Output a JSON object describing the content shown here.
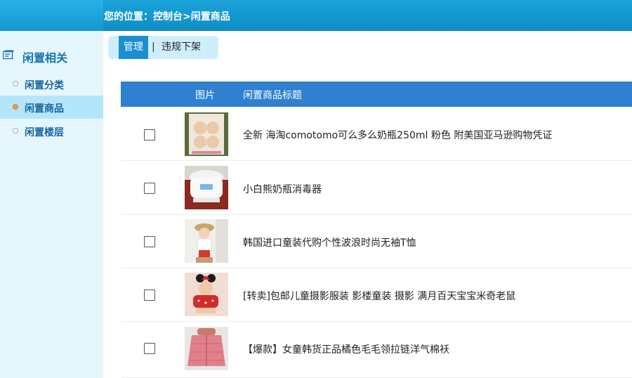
{
  "header": {
    "breadcrumb": "您的位置：控制台>闲置商品"
  },
  "sidebar": {
    "title": "闲置相关",
    "items": [
      {
        "label": "闲置分类",
        "active": false
      },
      {
        "label": "闲置商品",
        "active": true
      },
      {
        "label": "闲置楼层",
        "active": false
      }
    ]
  },
  "tabs": {
    "manage": "管理",
    "separator": "|",
    "offshelf": "违规下架"
  },
  "table": {
    "columns": {
      "image": "图片",
      "title": "闲置商品标题"
    },
    "rows": [
      {
        "title": "全新 海淘comotomo可么多么奶瓶250ml 粉色 附美国亚马逊购物凭证",
        "checked": false,
        "thumb": "baby-bottle-box"
      },
      {
        "title": "小白熊奶瓶消毒器",
        "checked": false,
        "thumb": "bottle-sterilizer"
      },
      {
        "title": "韩国进口童装代购个性波浪时尚无袖T恤",
        "checked": false,
        "thumb": "child-in-hat"
      },
      {
        "title": "[转卖]包邮儿童摄影服装 影楼童装 摄影 满月百天宝宝米奇老鼠",
        "checked": false,
        "thumb": "baby-minnie-costume"
      },
      {
        "title": "【爆款】女童韩货正品橘色毛毛领拉链洋气棉袄",
        "checked": false,
        "thumb": "pink-padded-jacket"
      }
    ]
  }
}
